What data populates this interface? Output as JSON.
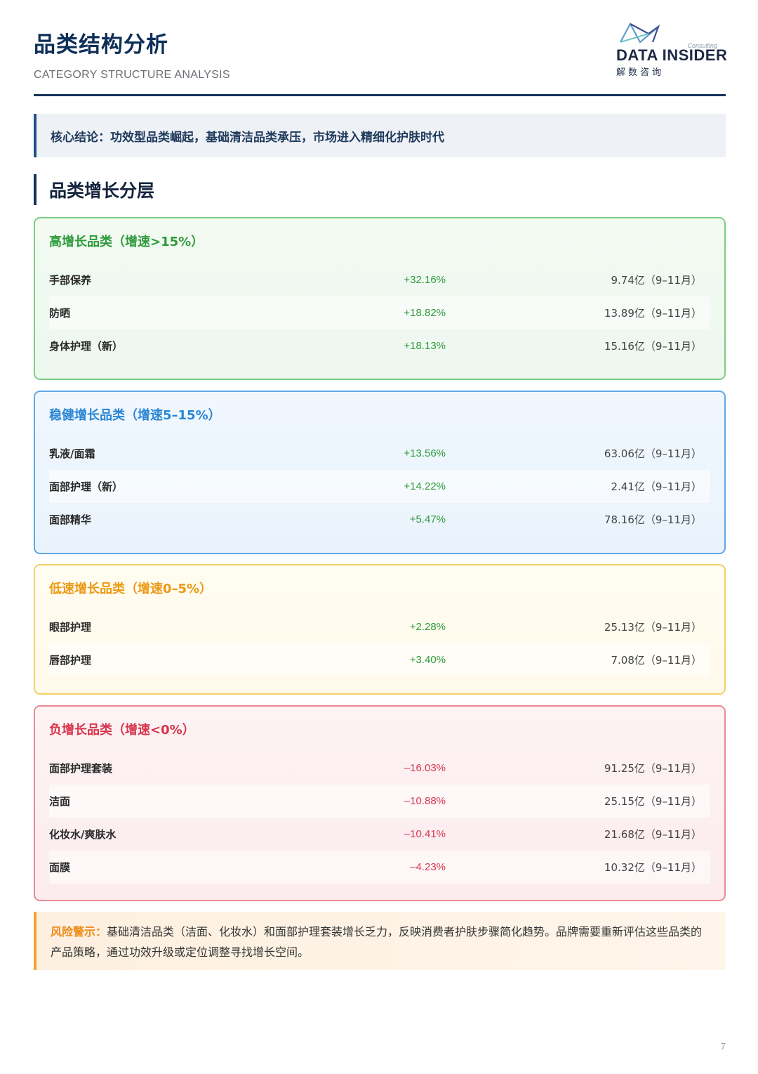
{
  "header": {
    "title": "品类结构分析",
    "subtitle": "CATEGORY STRUCTURE ANALYSIS"
  },
  "logo": {
    "consulting": "Consulting",
    "brand": "DATA INSIDER",
    "brand_cn": "解数咨询",
    "icon": "triangle-logo-icon"
  },
  "conclusion": "核心结论：功效型品类崛起，基础清洁品类承压，市场进入精细化护肤时代",
  "section_title": "品类增长分层",
  "tiers": [
    {
      "title": "高增长品类（增速>15%）",
      "color": "#2f9b3c",
      "rows": [
        {
          "name": "手部保养",
          "rate": "+32.16%",
          "size": "9.74亿（9–11月）"
        },
        {
          "name": "防晒",
          "rate": "+18.82%",
          "size": "13.89亿（9–11月）"
        },
        {
          "name": "身体护理（新）",
          "rate": "+18.13%",
          "size": "15.16亿（9–11月）"
        }
      ]
    },
    {
      "title": "稳健增长品类（增速5–15%）",
      "color": "#2a86d6",
      "rows": [
        {
          "name": "乳液/面霜",
          "rate": "+13.56%",
          "size": "63.06亿（9–11月）"
        },
        {
          "name": "面部护理（新）",
          "rate": "+14.22%",
          "size": "2.41亿（9–11月）"
        },
        {
          "name": "面部精华",
          "rate": "+5.47%",
          "size": "78.16亿（9–11月）"
        }
      ]
    },
    {
      "title": "低速增长品类（增速0–5%）",
      "color": "#ec9a16",
      "rows": [
        {
          "name": "眼部护理",
          "rate": "+2.28%",
          "size": "25.13亿（9–11月）"
        },
        {
          "name": "唇部护理",
          "rate": "+3.40%",
          "size": "7.08亿（9–11月）"
        }
      ]
    },
    {
      "title": "负增长品类（增速<0%）",
      "color": "#d7364c",
      "rows": [
        {
          "name": "面部护理套装",
          "rate": "–16.03%",
          "size": "91.25亿（9–11月）"
        },
        {
          "name": "洁面",
          "rate": "–10.88%",
          "size": "25.15亿（9–11月）"
        },
        {
          "name": "化妆水/爽肤水",
          "rate": "–10.41%",
          "size": "21.68亿（9–11月）"
        },
        {
          "name": "面膜",
          "rate": "–4.23%",
          "size": "10.32亿（9–11月）"
        }
      ]
    }
  ],
  "risk": {
    "label": "风险警示：",
    "text": "基础清洁品类（洁面、化妆水）和面部护理套装增长乏力，反映消费者护肤步骤简化趋势。品牌需要重新评估这些品类的产品策略，通过功效升级或定位调整寻找增长空间。"
  },
  "page_number": "7"
}
